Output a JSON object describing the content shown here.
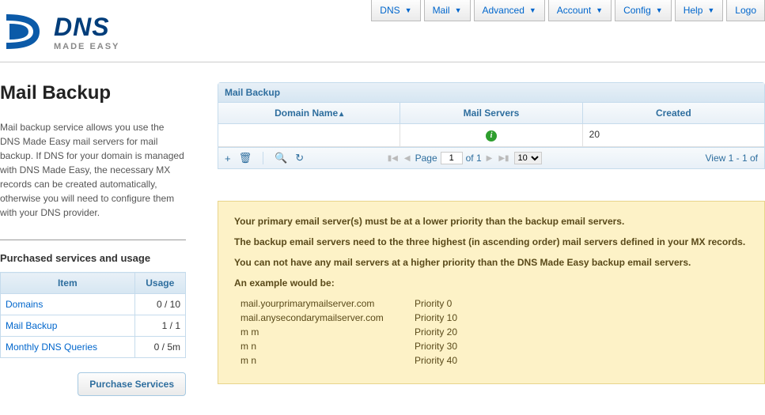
{
  "logo": {
    "brand_top": "DNS",
    "brand_bottom": "MADE EASY"
  },
  "nav": {
    "items": [
      {
        "label": "DNS"
      },
      {
        "label": "Mail"
      },
      {
        "label": "Advanced"
      },
      {
        "label": "Account"
      },
      {
        "label": "Config"
      },
      {
        "label": "Help"
      },
      {
        "label": "Logo"
      }
    ]
  },
  "page": {
    "title": "Mail Backup",
    "description": "Mail backup service allows you use the DNS Made Easy mail servers for mail backup. If DNS for your domain is managed with DNS Made Easy, the necessary MX records can be created automatically, otherwise you will need to configure them with your DNS provider."
  },
  "usage": {
    "title": "Purchased services and usage",
    "col_item": "Item",
    "col_usage": "Usage",
    "rows": [
      {
        "item": "Domains",
        "usage": "0 / 10"
      },
      {
        "item": "Mail Backup",
        "usage": "1 / 1"
      },
      {
        "item": "Monthly DNS Queries",
        "usage": "0 / 5m"
      }
    ],
    "purchase_btn": "Purchase Services"
  },
  "grid": {
    "panel_title": "Mail Backup",
    "cols": {
      "domain": "Domain Name",
      "servers": "Mail Servers",
      "created": "Created"
    },
    "row": {
      "domain": "",
      "servers_info": "i",
      "created": "20"
    },
    "pager": {
      "page_label": "Page",
      "page_current": "1",
      "of_label": "of 1",
      "page_size": "10",
      "view_label": "View 1 - 1 of"
    }
  },
  "notice": {
    "line1": "Your primary email server(s) must be at a lower priority than the backup email servers.",
    "line2": "The backup email servers need to the three highest (in ascending order) mail servers defined in your MX records.",
    "line3": "You can not have any mail servers at a higher priority than the DNS Made Easy backup email servers.",
    "example_intro": "An example would be:",
    "examples": [
      {
        "host": "mail.yourprimarymailserver.com",
        "priority": "Priority 0"
      },
      {
        "host": "mail.anysecondarymailserver.com",
        "priority": "Priority 10"
      },
      {
        "host": "m                          m",
        "priority": "Priority 20"
      },
      {
        "host": "m                          n",
        "priority": "Priority 30"
      },
      {
        "host": "m                          n",
        "priority": "Priority 40"
      }
    ]
  }
}
